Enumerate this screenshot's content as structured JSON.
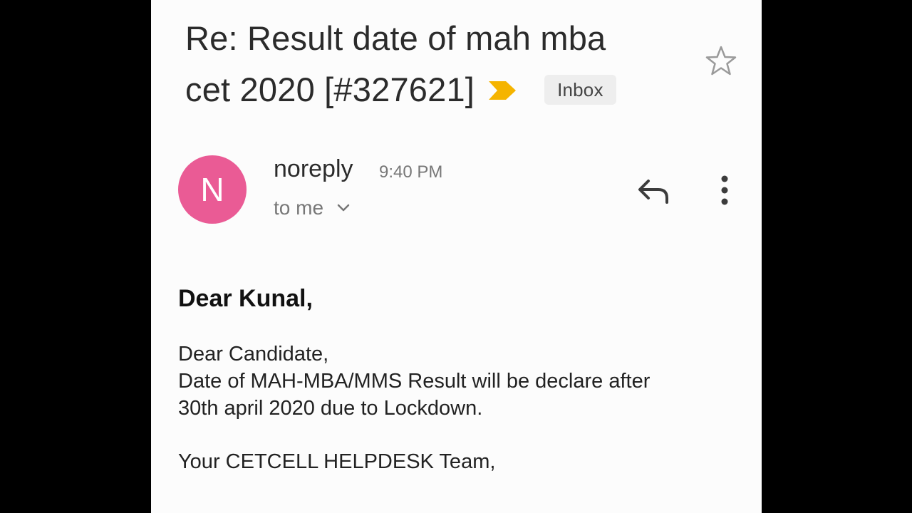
{
  "email": {
    "subject_line1": "Re: Result date of mah mba",
    "subject_line2": "cet 2020 [#327621]",
    "label": "Inbox",
    "sender": {
      "initial": "N",
      "name": "noreply",
      "time": "9:40 PM",
      "recipient": "to me"
    },
    "body": {
      "greeting": "Dear Kunal,",
      "lines": [
        "Dear Candidate,",
        "Date of MAH-MBA/MMS Result will be declare after",
        "30th april 2020 due to Lockdown."
      ],
      "signoff": "Your CETCELL HELPDESK Team,"
    }
  },
  "icons": {
    "star": "star-outline-icon",
    "importance": "importance-marker-icon",
    "reply": "reply-icon",
    "more": "more-vertical-icon",
    "expand": "chevron-down-icon"
  },
  "colors": {
    "avatar": "#ea5b95",
    "importance": "#f5b400",
    "chip_bg": "#eeeeee",
    "background": "#fcfcfc"
  }
}
